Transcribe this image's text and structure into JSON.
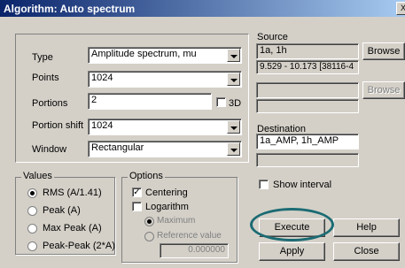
{
  "window": {
    "title": "Algorithm: Auto spectrum",
    "close_label": "X"
  },
  "left": {
    "type_label": "Type",
    "type_value": "Amplitude spectrum, mu",
    "points_label": "Points",
    "points_value": "1024",
    "portions_label": "Portions",
    "portions_value": "2",
    "threed_label": "3D",
    "shift_label": "Portion shift",
    "shift_value": "1024",
    "window_label": "Window",
    "window_value": "Rectangular"
  },
  "source": {
    "label": "Source",
    "value": "1a, 1h",
    "info": "9.529 - 10.173 [38116-4",
    "browse": "Browse",
    "browse2": "Browse"
  },
  "destination": {
    "label": "Destination",
    "value": "1a_AMP, 1h_AMP"
  },
  "values_group": {
    "caption": "Values",
    "items": [
      "RMS (A/1.41)",
      "Peak (A)",
      "Max Peak (A)",
      "Peak-Peak (2*A)"
    ]
  },
  "options_group": {
    "caption": "Options",
    "centering": "Centering",
    "logarithm": "Logarithm",
    "maximum": "Maximum",
    "reference": "Reference value",
    "ref_value": "0.000000"
  },
  "show_interval": "Show interval",
  "buttons": {
    "execute": "Execute",
    "help": "Help",
    "apply": "Apply",
    "close": "Close"
  },
  "highlight_color": "#1b6b73"
}
